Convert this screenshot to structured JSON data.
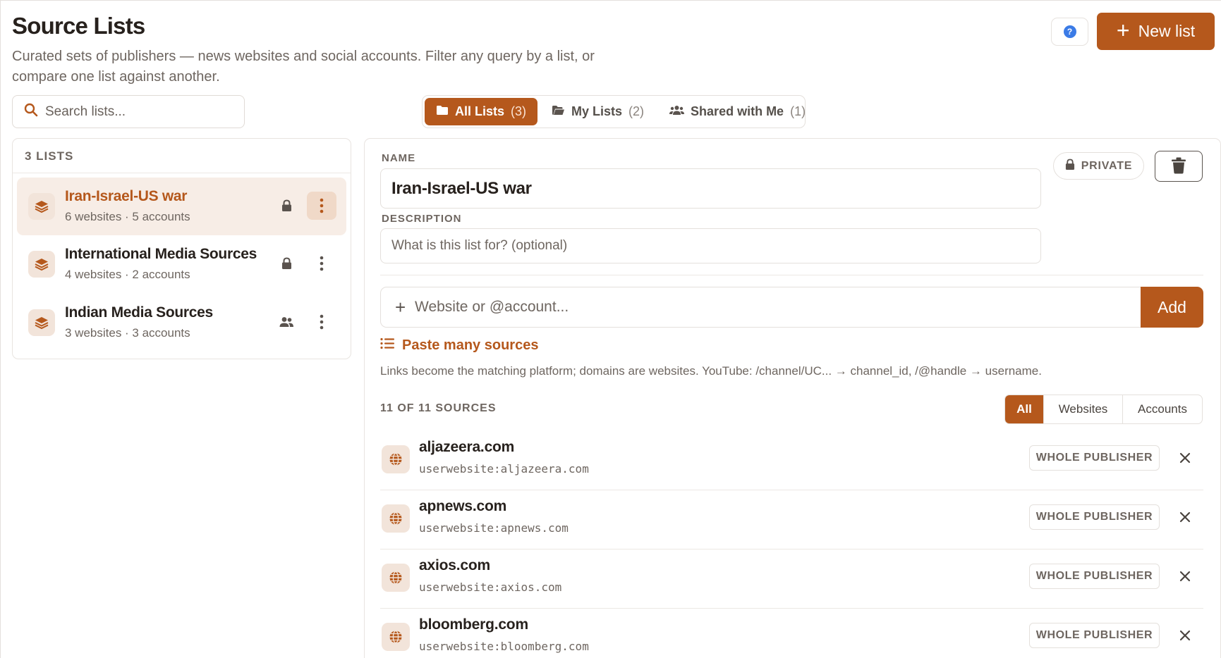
{
  "header": {
    "title": "Source Lists",
    "subtitle": "Curated sets of publishers — news websites and social accounts. Filter any query by a list, or compare one list against another.",
    "help_label": "?",
    "new_list_label": "New list"
  },
  "search": {
    "placeholder": "Search lists..."
  },
  "tabs": [
    {
      "label": "All Lists",
      "count": "(3)",
      "active": true
    },
    {
      "label": "My Lists",
      "count": "(2)",
      "active": false
    },
    {
      "label": "Shared with Me",
      "count": "(1)",
      "active": false
    }
  ],
  "lists": {
    "count_label": "3 LISTS",
    "items": [
      {
        "name": "Iran-Israel-US war",
        "meta": "6 websites · 5 accounts",
        "visibility": "lock-icon",
        "selected": true
      },
      {
        "name": "International Media Sources",
        "meta": "4 websites · 2 accounts",
        "visibility": "lock-icon",
        "selected": false
      },
      {
        "name": "Indian Media Sources",
        "meta": "3 websites · 3 accounts",
        "visibility": "people-icon",
        "selected": false
      }
    ]
  },
  "detail": {
    "name_label": "NAME",
    "name_value": "Iran-Israel-US war",
    "description_label": "DESCRIPTION",
    "description_placeholder": "What is this list for? (optional)",
    "private_label": "PRIVATE",
    "add_placeholder": "Website or @account...",
    "add_label": "Add",
    "paste_label": "Paste many sources",
    "hint": "Links become the matching platform; domains are websites. YouTube: /channel/UC... → channel_id, /@handle → username.",
    "sources_count": "11 OF 11 SOURCES",
    "filters": [
      {
        "label": "All",
        "active": true
      },
      {
        "label": "Websites",
        "active": false
      },
      {
        "label": "Accounts",
        "active": false
      }
    ],
    "sources": [
      {
        "name": "aljazeera.com",
        "query": "userwebsite:aljazeera.com",
        "scope": "WHOLE PUBLISHER"
      },
      {
        "name": "apnews.com",
        "query": "userwebsite:apnews.com",
        "scope": "WHOLE PUBLISHER"
      },
      {
        "name": "axios.com",
        "query": "userwebsite:axios.com",
        "scope": "WHOLE PUBLISHER"
      },
      {
        "name": "bloomberg.com",
        "query": "userwebsite:bloomberg.com",
        "scope": "WHOLE PUBLISHER"
      }
    ]
  },
  "colors": {
    "accent": "#b5581c",
    "accent_soft": "#f7ede6",
    "icon_bg": "#f2e4da",
    "help_blue": "#3b7be6",
    "text": "#27211d",
    "muted": "#6e6660"
  }
}
